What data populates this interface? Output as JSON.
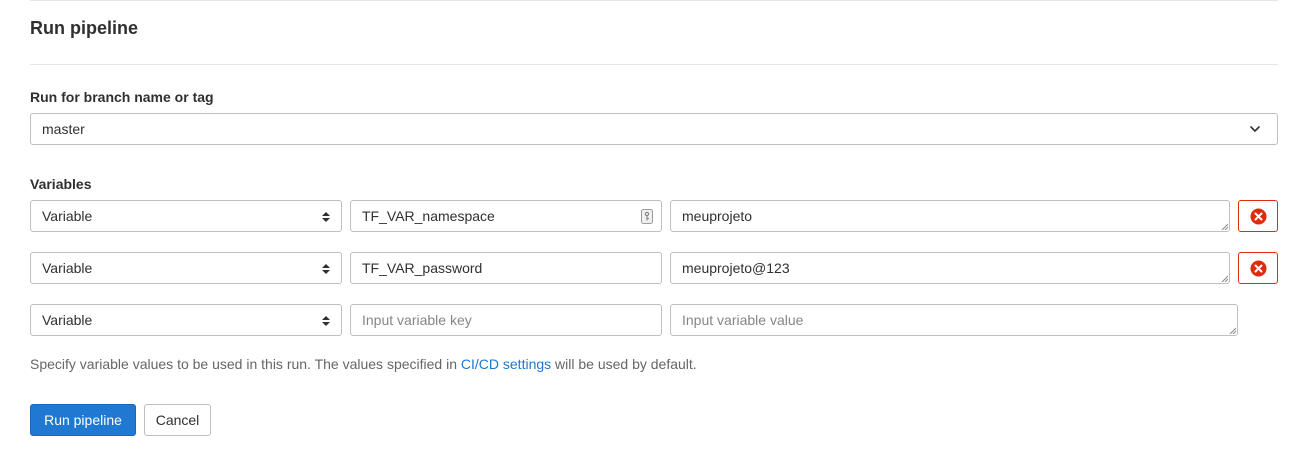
{
  "page": {
    "title": "Run pipeline"
  },
  "branch": {
    "label": "Run for branch name or tag",
    "value": "master"
  },
  "variables": {
    "label": "Variables",
    "rows": [
      {
        "type": "Variable",
        "key": "TF_VAR_namespace",
        "value": "meuprojeto"
      },
      {
        "type": "Variable",
        "key": "TF_VAR_password",
        "value": "meuprojeto@123"
      },
      {
        "type": "Variable",
        "key": "",
        "value": ""
      }
    ],
    "key_placeholder": "Input variable key",
    "value_placeholder": "Input variable value"
  },
  "help": {
    "text_before": "Specify variable values to be used in this run. The values specified in ",
    "link": "CI/CD settings",
    "text_after": " will be used by default."
  },
  "actions": {
    "run_label": "Run pipeline",
    "cancel_label": "Cancel"
  },
  "colors": {
    "primary": "#1f78d1",
    "danger": "#dd2b0e",
    "link": "#1f78d1"
  },
  "icons": {
    "dropdown": "chevron-down-icon",
    "select": "select-arrows-icon",
    "remove": "remove-circle-icon",
    "key": "key-icon"
  }
}
